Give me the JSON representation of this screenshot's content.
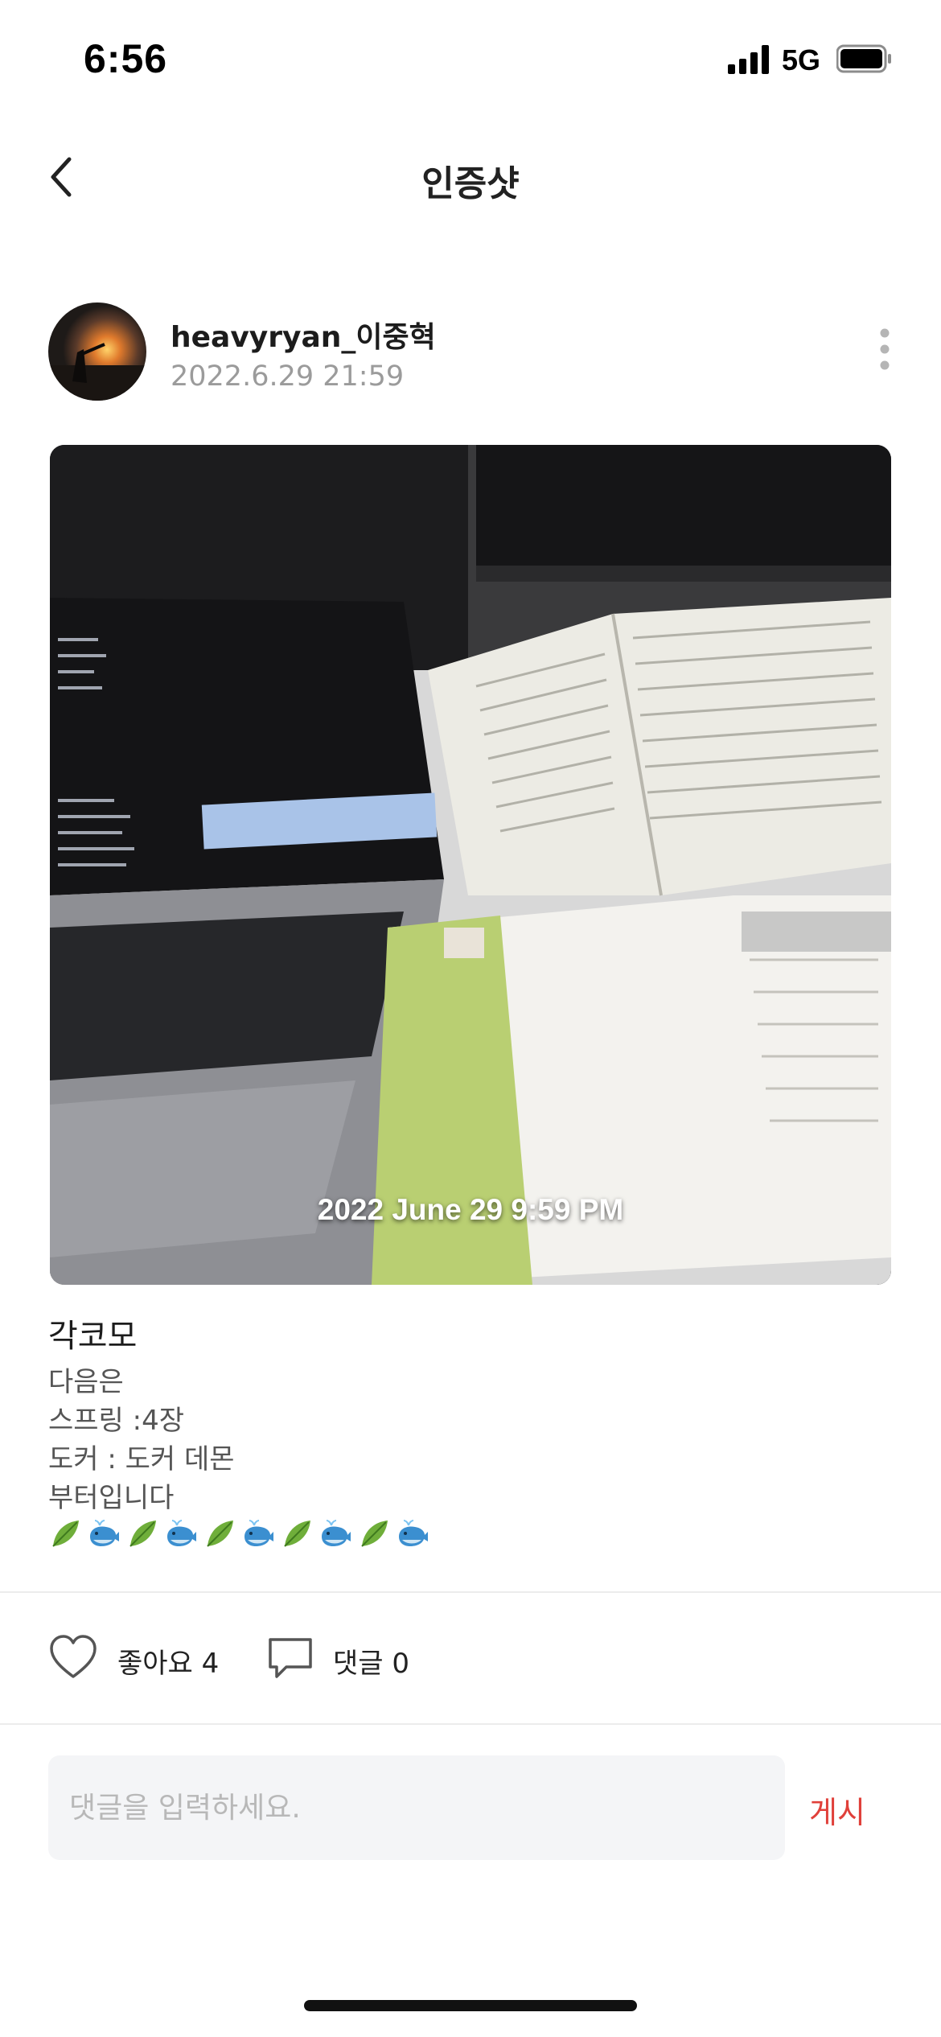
{
  "status_bar": {
    "time": "6:56",
    "network": "5G"
  },
  "header": {
    "title": "인증샷"
  },
  "post": {
    "username": "heavyryan_이중혁",
    "date": "2022.6.29 21:59",
    "photo_stamp": "2022 June 29 9:59 PM",
    "title": "각코모",
    "body_lines": [
      "다음은",
      "스프링 :4장",
      "도커 : 도커 데몬",
      "부터입니다"
    ],
    "emoji_sequence": [
      "leaf-emoji",
      "whale-emoji",
      "leaf-emoji",
      "whale-emoji",
      "leaf-emoji",
      "whale-emoji",
      "leaf-emoji",
      "whale-emoji",
      "leaf-emoji",
      "whale-emoji"
    ]
  },
  "actions": {
    "like_label": "좋아요 4",
    "comment_label": "댓글 0"
  },
  "comment_input": {
    "placeholder": "댓글을 입력하세요.",
    "submit_label": "게시"
  },
  "colors": {
    "accent": "#e0403a",
    "muted_text": "#9b9b9b",
    "input_bg": "#f4f5f7"
  },
  "icons": [
    "back-chevron-icon",
    "more-vertical-icon",
    "heart-icon",
    "comment-bubble-icon"
  ]
}
